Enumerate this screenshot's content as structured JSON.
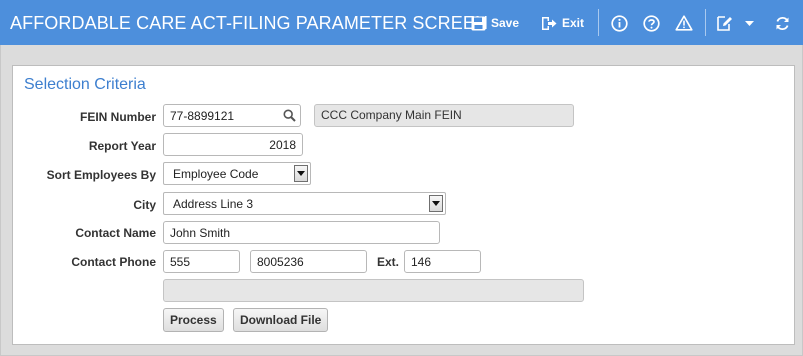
{
  "header": {
    "title": "AFFORDABLE CARE ACT-FILING PARAMETER SCREEN",
    "save_label": "Save",
    "exit_label": "Exit",
    "icons": [
      "save-icon",
      "exit-icon",
      "info-icon",
      "help-icon",
      "warning-icon",
      "edit-icon",
      "chevron-down-icon",
      "refresh-icon"
    ],
    "colors": {
      "bar": "#4d8fdc",
      "text": "#ffffff"
    }
  },
  "panel": {
    "title": "Selection Criteria",
    "title_color": "#3d7fcf"
  },
  "form": {
    "fein": {
      "label": "FEIN Number",
      "value": "77-8899121",
      "description": "CCC Company Main FEIN"
    },
    "report_year": {
      "label": "Report Year",
      "value": "2018"
    },
    "sort_by": {
      "label": "Sort Employees By",
      "value": "Employee Code"
    },
    "city": {
      "label": "City",
      "value": "Address Line 3"
    },
    "contact_name": {
      "label": "Contact Name",
      "value": "John Smith"
    },
    "contact_phone": {
      "label": "Contact Phone",
      "area": "555",
      "number": "8005236",
      "ext_label": "Ext.",
      "ext": "146"
    },
    "status": {
      "value": ""
    }
  },
  "buttons": {
    "process": "Process",
    "download": "Download File"
  }
}
